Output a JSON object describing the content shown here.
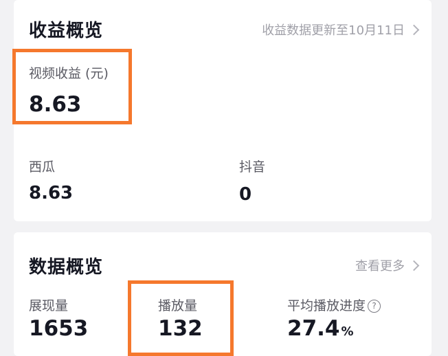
{
  "revenue_overview": {
    "title": "收益概览",
    "update_link": "收益数据更新至10月11日",
    "video_revenue_label": "视频收益 (元)",
    "video_revenue_value": "8.63",
    "xigua_label": "西瓜",
    "xigua_value": "8.63",
    "douyin_label": "抖音",
    "douyin_value": "0"
  },
  "data_overview": {
    "title": "数据概览",
    "more_link": "查看更多",
    "impressions_label": "展现量",
    "impressions_value": "1653",
    "plays_label": "播放量",
    "plays_value": "132",
    "avg_progress_label": "平均播放进度",
    "avg_progress_value": "27.4",
    "avg_progress_unit": "%"
  },
  "colors": {
    "highlight": "#f5782d",
    "card_background": "#ffffff",
    "page_background": "#f2f2f4"
  },
  "icons": {
    "chevron": "chevron-right-icon",
    "help": "question-circle-icon"
  }
}
